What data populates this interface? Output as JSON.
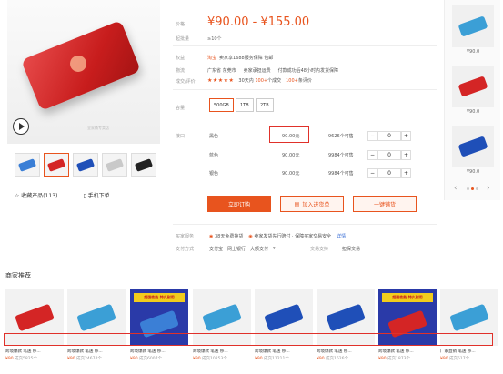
{
  "product": {
    "watermark": "全家桶专卖店",
    "thumbs_colors": [
      "#3b7fd6",
      "#d42525",
      "#1f4fb8",
      "#c9c9c9",
      "#222222"
    ],
    "fav_label": "收藏产品(113)",
    "phone_label": "手机下单"
  },
  "details": {
    "price_label": "价格",
    "price_range": "¥90.00 - ¥155.00",
    "moq_label": "起批量",
    "moq_value": "≥10个",
    "perks_label": "权益",
    "perks_badge": "淘宝",
    "perks_text": "卖家享1688服务保障 包邮",
    "logistics_label": "物流",
    "logistics_from": "广东省 东莞市",
    "logistics_to": "卖家承担运费",
    "logistics_note": "付款成功后48小时内发货保障",
    "rating_label": "成交/评价",
    "rating_stars": "★★★★★",
    "sales_30": "30天内",
    "sales_30_num": "100+",
    "sales_30_unit": "个成交",
    "reviews_num": "100+",
    "reviews_unit": "条评价",
    "capacity_label": "容量",
    "capacity_options": [
      "500GB",
      "1TB",
      "2TB"
    ],
    "port_label": "接口",
    "variants": [
      {
        "color": "黑色",
        "price": "90.00元",
        "stock": "9626个可售",
        "qty": "0"
      },
      {
        "color": "蓝色",
        "price": "90.00元",
        "stock": "9984个可售",
        "qty": "0"
      },
      {
        "color": "银色",
        "price": "90.00元",
        "stock": "9984个可售",
        "qty": "0"
      }
    ],
    "qty_minus": "−",
    "qty_plus": "+",
    "buy_label": "立即订购",
    "cart_label": "加入进货单",
    "quote_label": "一键铺货",
    "service_label": "买家服务",
    "service_items": [
      "38天免费换货",
      "卖家发货先行赔付 · 保障买家交易安全"
    ],
    "service_link": "详情",
    "pay_label": "支付方式",
    "pay_items": [
      "支付宝",
      "网上银行",
      "大额支付"
    ],
    "pay_more": "▾",
    "support_label": "交易支持",
    "support_value": "担保交易"
  },
  "right_col": {
    "items": [
      {
        "price": "¥90.0",
        "color": "#3b9fd6"
      },
      {
        "price": "¥90.0",
        "color": "#d42525"
      },
      {
        "price": "¥90.0",
        "color": "#1f4fb8"
      }
    ],
    "nav_left": "‹",
    "nav_right": "›"
  },
  "recommend": {
    "title": "商家推荐",
    "items": [
      {
        "name": "跨境爆款 笔送 移...",
        "price": "¥90",
        "sold": "成交5825个",
        "color": "#d42525",
        "promo": false
      },
      {
        "name": "跨境爆款 笔送 移...",
        "price": "¥90",
        "sold": "成交24674个",
        "color": "#3b9fd6",
        "promo": false
      },
      {
        "name": "跨境爆款 笔送 移...",
        "price": "¥90",
        "sold": "成交6007个",
        "color": "#3b7fd6",
        "promo": true
      },
      {
        "name": "跨境爆款 笔送 移...",
        "price": "¥90",
        "sold": "成交10253个",
        "color": "#3b9fd6",
        "promo": false
      },
      {
        "name": "跨境爆款 笔送 移...",
        "price": "¥90",
        "sold": "成交11211个",
        "color": "#1f4fb8",
        "promo": false
      },
      {
        "name": "跨境爆款 笔送 移...",
        "price": "¥90",
        "sold": "成交1626个",
        "color": "#1f4fb8",
        "promo": false
      },
      {
        "name": "跨境爆款 笔送 移...",
        "price": "¥90",
        "sold": "成交1873个",
        "color": "#d42525",
        "promo": true
      },
      {
        "name": "厂家直销 笔送 移...",
        "price": "¥90",
        "sold": "成交517个",
        "color": "#3b9fd6",
        "promo": false
      }
    ],
    "promo_text": "超强性能 特久耐用"
  }
}
